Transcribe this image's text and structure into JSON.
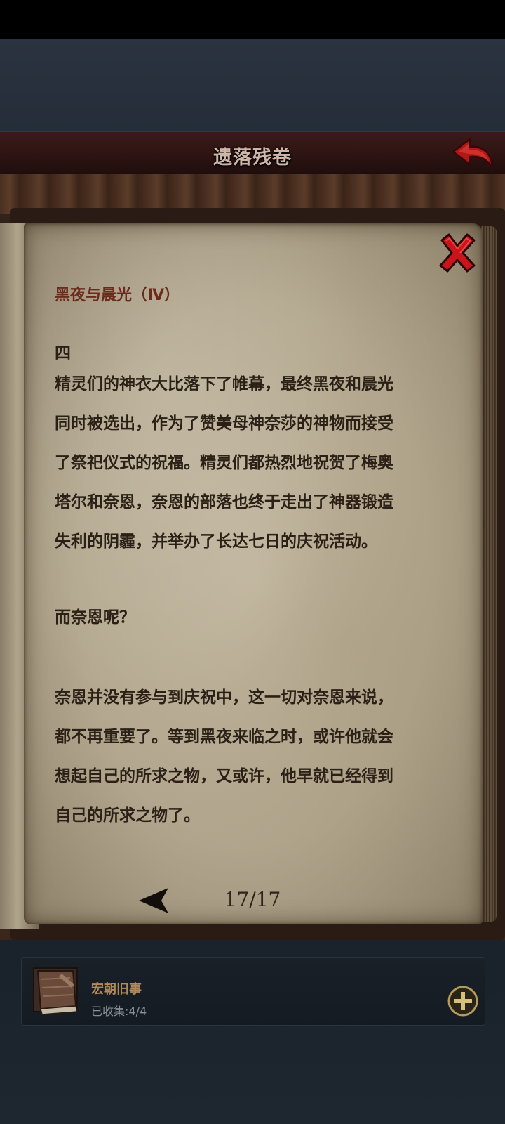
{
  "header": {
    "title": "遗落残卷",
    "back_icon": "back-arrow-icon"
  },
  "entry": {
    "title": "黑夜与晨光（Ⅳ）",
    "close_icon": "close-icon",
    "lines": [
      "四",
      "精灵们的神衣大比落下了帷幕，最终黑夜和晨光",
      "同时被选出，作为了赞美母神奈莎的神物而接受",
      "了祭祀仪式的祝福。精灵们都热烈地祝贺了梅奥",
      "塔尔和奈恩，奈恩的部落也终于走出了神器锻造",
      "失利的阴霾，并举办了长达七日的庆祝活动。",
      "而奈恩呢？",
      "奈恩并没有参与到庆祝中，这一切对奈恩来说，",
      "都不再重要了。等到黑夜来临之时，或许他就会",
      "想起自己的所求之物，又或许，他早就已经得到",
      "自己的所求之物了。"
    ]
  },
  "pagination": {
    "prev_icon": "prev-page-arrow-icon",
    "counter": "17/17",
    "current_page": 17,
    "total_pages": 17
  },
  "collection": {
    "icon": "book-icon",
    "name": "宏朝旧事",
    "progress": "已收集:4/4",
    "add_icon": "plus-icon"
  },
  "colors": {
    "header_bg": "#2c1412",
    "title_text": "#cdb6a8",
    "entry_title": "#6b2a1a",
    "body_text": "#2b2016",
    "close_red": "#c8141a",
    "back_red": "#b01818",
    "collection_name": "#b08a5a"
  }
}
